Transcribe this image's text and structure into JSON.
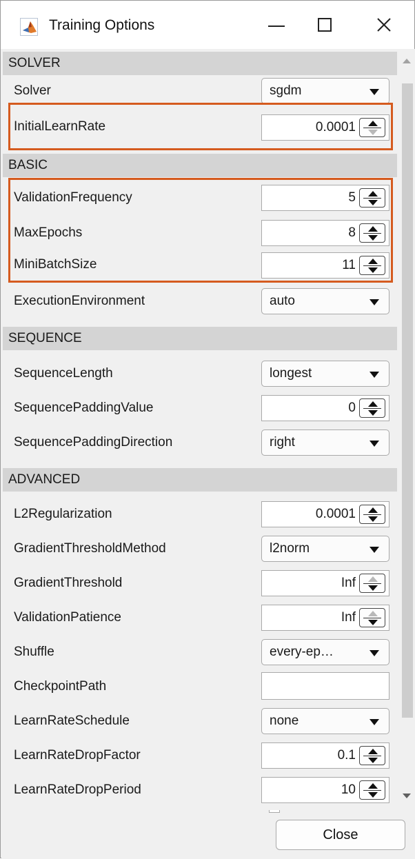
{
  "window": {
    "title": "Training Options"
  },
  "sections": {
    "solver": "SOLVER",
    "basic": "BASIC",
    "sequence": "SEQUENCE",
    "advanced": "ADVANCED"
  },
  "solver": {
    "solver_label": "Solver",
    "solver_value": "sgdm",
    "initial_learn_rate_label": "InitialLearnRate",
    "initial_learn_rate_value": "0.0001"
  },
  "basic": {
    "validation_frequency_label": "ValidationFrequency",
    "validation_frequency_value": "5",
    "max_epochs_label": "MaxEpochs",
    "max_epochs_value": "8",
    "mini_batch_size_label": "MiniBatchSize",
    "mini_batch_size_value": "11",
    "execution_environment_label": "ExecutionEnvironment",
    "execution_environment_value": "auto"
  },
  "sequence": {
    "sequence_length_label": "SequenceLength",
    "sequence_length_value": "longest",
    "sequence_padding_value_label": "SequencePaddingValue",
    "sequence_padding_value_value": "0",
    "sequence_padding_direction_label": "SequencePaddingDirection",
    "sequence_padding_direction_value": "right"
  },
  "advanced": {
    "l2_label": "L2Regularization",
    "l2_value": "0.0001",
    "gradient_threshold_method_label": "GradientThresholdMethod",
    "gradient_threshold_method_value": "l2norm",
    "gradient_threshold_label": "GradientThreshold",
    "gradient_threshold_value": "Inf",
    "validation_patience_label": "ValidationPatience",
    "validation_patience_value": "Inf",
    "shuffle_label": "Shuffle",
    "shuffle_value": "every-ep…",
    "checkpoint_path_label": "CheckpointPath",
    "checkpoint_path_value": "",
    "learn_rate_schedule_label": "LearnRateSchedule",
    "learn_rate_schedule_value": "none",
    "learn_rate_drop_factor_label": "LearnRateDropFactor",
    "learn_rate_drop_factor_value": "0.1",
    "learn_rate_drop_period_label": "LearnRateDropPeriod",
    "learn_rate_drop_period_value": "10"
  },
  "footer": {
    "close_label": "Close"
  },
  "colors": {
    "highlight": "#d55b1f",
    "section_header": "#d4d4d4",
    "background": "#f0f0f0"
  }
}
